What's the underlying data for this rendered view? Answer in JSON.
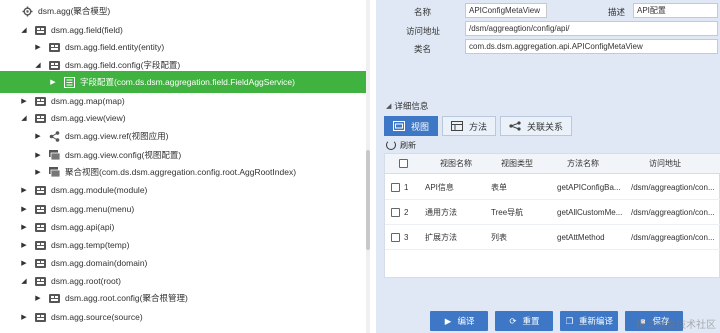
{
  "tree": {
    "items": [
      {
        "label": "dsm.agg(聚合模型)",
        "expanded": true,
        "icon": "gear-icon"
      },
      {
        "label": "dsm.agg.field(field)",
        "expanded": true,
        "icon": "tree-node-icon"
      },
      {
        "label": "dsm.agg.field.entity(entity)",
        "expanded": false,
        "icon": "tree-node-icon"
      },
      {
        "label": "dsm.agg.field.config(字段配置)",
        "expanded": true,
        "icon": "tree-node-icon"
      },
      {
        "label": "字段配置(com.ds.dsm.aggregation.field.FieldAggService)",
        "expanded": false,
        "icon": "document-icon",
        "selected": true
      },
      {
        "label": "dsm.agg.map(map)",
        "expanded": false,
        "icon": "tree-node-icon"
      },
      {
        "label": "dsm.agg.view(view)",
        "expanded": true,
        "icon": "tree-node-icon"
      },
      {
        "label": "dsm.agg.view.ref(视图应用)",
        "expanded": false,
        "icon": "share-icon"
      },
      {
        "label": "dsm.agg.view.config(视图配置)",
        "expanded": false,
        "icon": "view-icon"
      },
      {
        "label": "聚合视图(com.ds.dsm.aggregation.config.root.AggRootIndex)",
        "expanded": false,
        "icon": "view-icon"
      },
      {
        "label": "dsm.agg.module(module)",
        "expanded": false,
        "icon": "tree-node-icon"
      },
      {
        "label": "dsm.agg.menu(menu)",
        "expanded": false,
        "icon": "tree-node-icon"
      },
      {
        "label": "dsm.agg.api(api)",
        "expanded": false,
        "icon": "tree-node-icon"
      },
      {
        "label": "dsm.agg.temp(temp)",
        "expanded": false,
        "icon": "tree-node-icon"
      },
      {
        "label": "dsm.agg.domain(domain)",
        "expanded": false,
        "icon": "tree-node-icon"
      },
      {
        "label": "dsm.agg.root(root)",
        "expanded": true,
        "icon": "tree-node-icon"
      },
      {
        "label": "dsm.agg.root.config(聚合根管理)",
        "expanded": false,
        "icon": "tree-node-icon"
      },
      {
        "label": "dsm.agg.source(source)",
        "expanded": false,
        "icon": "tree-node-icon"
      }
    ]
  },
  "form": {
    "name_label": "名称",
    "name_value": "APIConfigMetaView",
    "desc_label": "描述",
    "desc_value": "API配置",
    "url_label": "访问地址",
    "url_value": "/dsm/aggreagtion/config/api/",
    "class_label": "类名",
    "class_value": "com.ds.dsm.aggregation.api.APIConfigMetaView"
  },
  "detail": {
    "section_title": "详细信息",
    "tabs": [
      {
        "label": "视图",
        "icon": "view-icon",
        "active": true
      },
      {
        "label": "方法",
        "icon": "method-icon",
        "active": false
      },
      {
        "label": "关联关系",
        "icon": "relation-icon",
        "active": false
      }
    ],
    "refresh_label": "刷新",
    "columns": [
      "视图名称",
      "视图类型",
      "方法名称",
      "访问地址"
    ],
    "rows": [
      {
        "index": "1",
        "name": "API信息",
        "type": "表单",
        "method": "getAPIConfigBa...",
        "url": "/dsm/aggreagtion/con..."
      },
      {
        "index": "2",
        "name": "通用方法",
        "type": "Tree导航",
        "method": "getAllCustomMe...",
        "url": "/dsm/aggreagtion/con..."
      },
      {
        "index": "3",
        "name": "扩展方法",
        "type": "列表",
        "method": "getAttMethod",
        "url": "/dsm/aggreagtion/con..."
      }
    ]
  },
  "footer": {
    "compile_label": "编译",
    "reset_label": "重置",
    "reindex_label": "重新编译",
    "save_label": "保存"
  },
  "watermark": "稀土掘金技术社区",
  "colors": {
    "accent": "#3d77c6",
    "selected": "#3fb23f",
    "panel_bg": "#dfe8f4"
  }
}
